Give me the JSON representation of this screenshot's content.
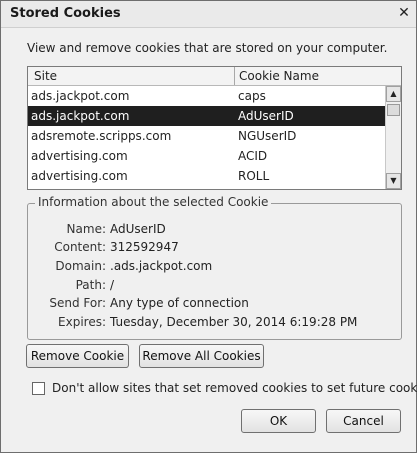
{
  "window": {
    "title": "Stored Cookies",
    "close_glyph": "✕"
  },
  "description": "View and remove cookies that are stored on your computer.",
  "list": {
    "columns": [
      "Site",
      "Cookie Name"
    ],
    "rows": [
      {
        "site": "ads.jackpot.com",
        "name": "caps"
      },
      {
        "site": "ads.jackpot.com",
        "name": "AdUserID"
      },
      {
        "site": "adsremote.scripps.com",
        "name": "NGUserID"
      },
      {
        "site": "advertising.com",
        "name": "ACID"
      },
      {
        "site": "advertising.com",
        "name": "ROLL"
      }
    ],
    "selected_index": 1
  },
  "info": {
    "title": "Information about the selected Cookie",
    "fields": [
      {
        "label": "Name:",
        "value": "AdUserID"
      },
      {
        "label": "Content:",
        "value": "312592947"
      },
      {
        "label": "Domain:",
        "value": ".ads.jackpot.com"
      },
      {
        "label": "Path:",
        "value": "/"
      },
      {
        "label": "Send For:",
        "value": "Any type of connection"
      },
      {
        "label": "Expires:",
        "value": "Tuesday, December 30, 2014 6:19:28 PM"
      }
    ]
  },
  "buttons": {
    "remove_cookie": "Remove Cookie",
    "remove_all": "Remove All Cookies",
    "ok": "OK",
    "cancel": "Cancel"
  },
  "checkbox": {
    "label": "Don't allow sites that set removed cookies to set future cookies",
    "checked": false
  },
  "icons": {
    "scroll_up": "▲",
    "scroll_down": "▼"
  }
}
